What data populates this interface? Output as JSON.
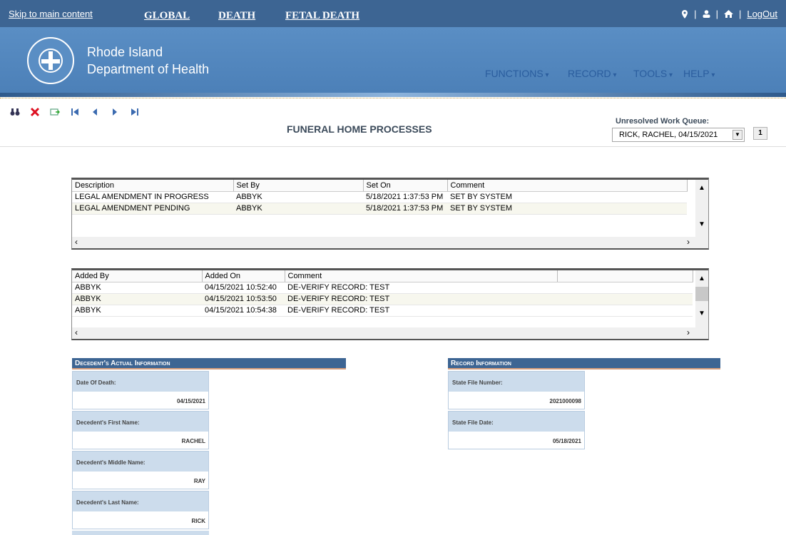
{
  "topbar": {
    "skip": "Skip to main content",
    "nav": [
      "GLOBAL",
      "DEATH",
      "FETAL DEATH"
    ],
    "logout": "LogOut"
  },
  "banner": {
    "org_line1": "Rhode Island",
    "org_line2": "Department of Health",
    "menu": [
      "FUNCTIONS",
      "RECORD",
      "TOOLS",
      "HELP"
    ]
  },
  "page": {
    "title": "FUNERAL HOME PROCESSES",
    "uwq_label": "Unresolved Work Queue:",
    "uwq_value": "RICK, RACHEL, 04/15/2021",
    "uwq_count": "1"
  },
  "flags_grid": {
    "headers": [
      "Description",
      "Set By",
      "Set On",
      "Comment"
    ],
    "rows": [
      [
        "LEGAL AMENDMENT IN PROGRESS",
        "ABBYK",
        "5/18/2021 1:37:53 PM",
        "SET BY SYSTEM"
      ],
      [
        "LEGAL AMENDMENT PENDING",
        "ABBYK",
        "5/18/2021 1:37:53 PM",
        "SET BY SYSTEM"
      ]
    ]
  },
  "notes_grid": {
    "headers": [
      "Added By",
      "Added On",
      "Comment"
    ],
    "rows": [
      [
        "ABBYK",
        "04/15/2021 10:52:40",
        "DE-VERIFY RECORD: TEST"
      ],
      [
        "ABBYK",
        "04/15/2021 10:53:50",
        "DE-VERIFY RECORD: TEST"
      ],
      [
        "ABBYK",
        "04/15/2021 10:54:38",
        "DE-VERIFY RECORD: TEST"
      ]
    ]
  },
  "decedent": {
    "title": "Decedent's Actual Information",
    "fields": [
      {
        "label": "Date Of Death:",
        "value": "04/15/2021"
      },
      {
        "label": "Decedent's First Name:",
        "value": "RACHEL"
      },
      {
        "label": "Decedent's Middle Name:",
        "value": "RAY"
      },
      {
        "label": "Decedent's Last Name:",
        "value": "RICK"
      }
    ]
  },
  "record": {
    "title": "Record Information",
    "fields": [
      {
        "label": "State File Number:",
        "value": "2021000098"
      },
      {
        "label": "State File Date:",
        "value": "05/18/2021"
      }
    ]
  },
  "colors": {
    "header_blue": "#3d6593",
    "banner_blue": "#5a8ec4",
    "menu_blue": "#2a5d9e"
  }
}
